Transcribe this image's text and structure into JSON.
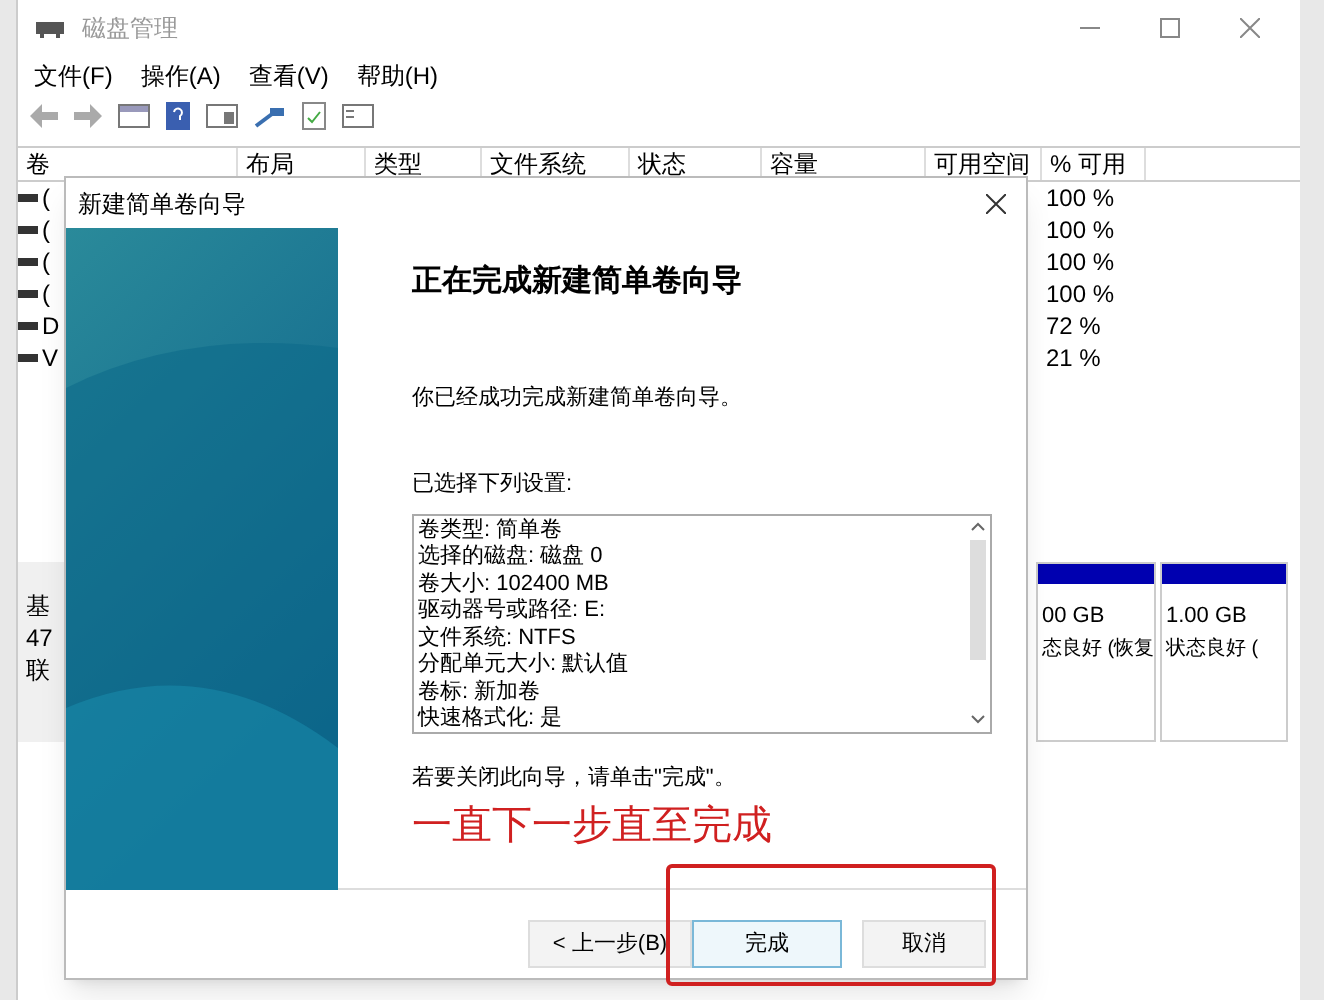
{
  "window": {
    "title": "磁盘管理"
  },
  "menu": [
    "文件(F)",
    "操作(A)",
    "查看(V)",
    "帮助(H)"
  ],
  "table": {
    "columns": [
      "卷",
      "布局",
      "类型",
      "文件系统",
      "状态",
      "容量",
      "可用空间",
      "% 可用"
    ],
    "rows": [
      {
        "volume": "(",
        "free_pct": "100 %"
      },
      {
        "volume": "(",
        "free_pct": "100 %"
      },
      {
        "volume": "(",
        "free_pct": "100 %"
      },
      {
        "volume": "(",
        "free_pct": "100 %"
      },
      {
        "volume": "D",
        "free_pct": "72 %"
      },
      {
        "volume": "V",
        "free_pct": "21 %"
      }
    ]
  },
  "disk": {
    "lines": [
      "基",
      "47",
      "联"
    ],
    "partitions": [
      {
        "size": "00 GB",
        "status": "态良好 (恢复"
      },
      {
        "size": "1.00 GB",
        "status": "状态良好 ("
      }
    ]
  },
  "dialog": {
    "title": "新建简单卷向导",
    "heading": "正在完成新建简单卷向导",
    "message": "你已经成功完成新建简单卷向导。",
    "settings_label": "已选择下列设置:",
    "settings": [
      "卷类型: 简单卷",
      "选择的磁盘: 磁盘 0",
      "卷大小: 102400 MB",
      "驱动器号或路径: E:",
      "文件系统: NTFS",
      "分配单元大小: 默认值",
      "卷标: 新加卷",
      "快速格式化: 是"
    ],
    "close_hint": "若要关闭此向导，请单击\"完成\"。",
    "buttons": [
      {
        "label": "< 上一步(B)",
        "selected": false
      },
      {
        "label": "完成",
        "selected": true
      },
      {
        "label": "取消",
        "selected": false
      }
    ]
  },
  "annotation": {
    "text": "一直下一步直至完成"
  }
}
